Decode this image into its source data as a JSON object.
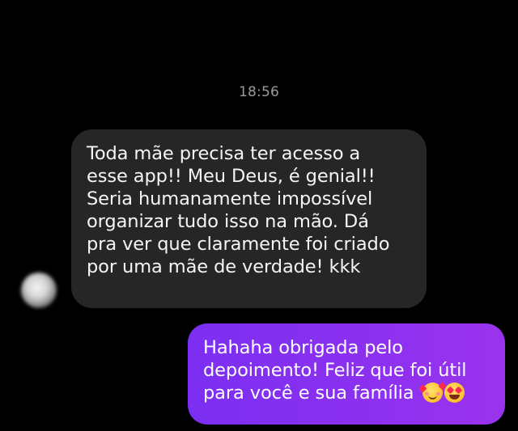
{
  "chat": {
    "timestamp": "18:56",
    "incoming": {
      "avatar_icon": "blurred-avatar",
      "lines": [
        "Toda mãe precisa ter acesso a",
        "esse app!! Meu Deus, é genial!!",
        "Seria humanamente impossível",
        "organizar tudo isso na mão. Dá",
        "pra ver que claramente foi criado",
        "por uma mãe de verdade! kkk"
      ]
    },
    "outgoing": {
      "gradient_colors": [
        "#7b2ff2",
        "#9a33ee"
      ],
      "lines": [
        "Hahaha obrigada pelo",
        "depoimento! Feliz que foi útil",
        "para você e sua família"
      ],
      "emojis": [
        "smiling-face-with-hearts-emoji",
        "heart-eyes-emoji"
      ]
    }
  }
}
